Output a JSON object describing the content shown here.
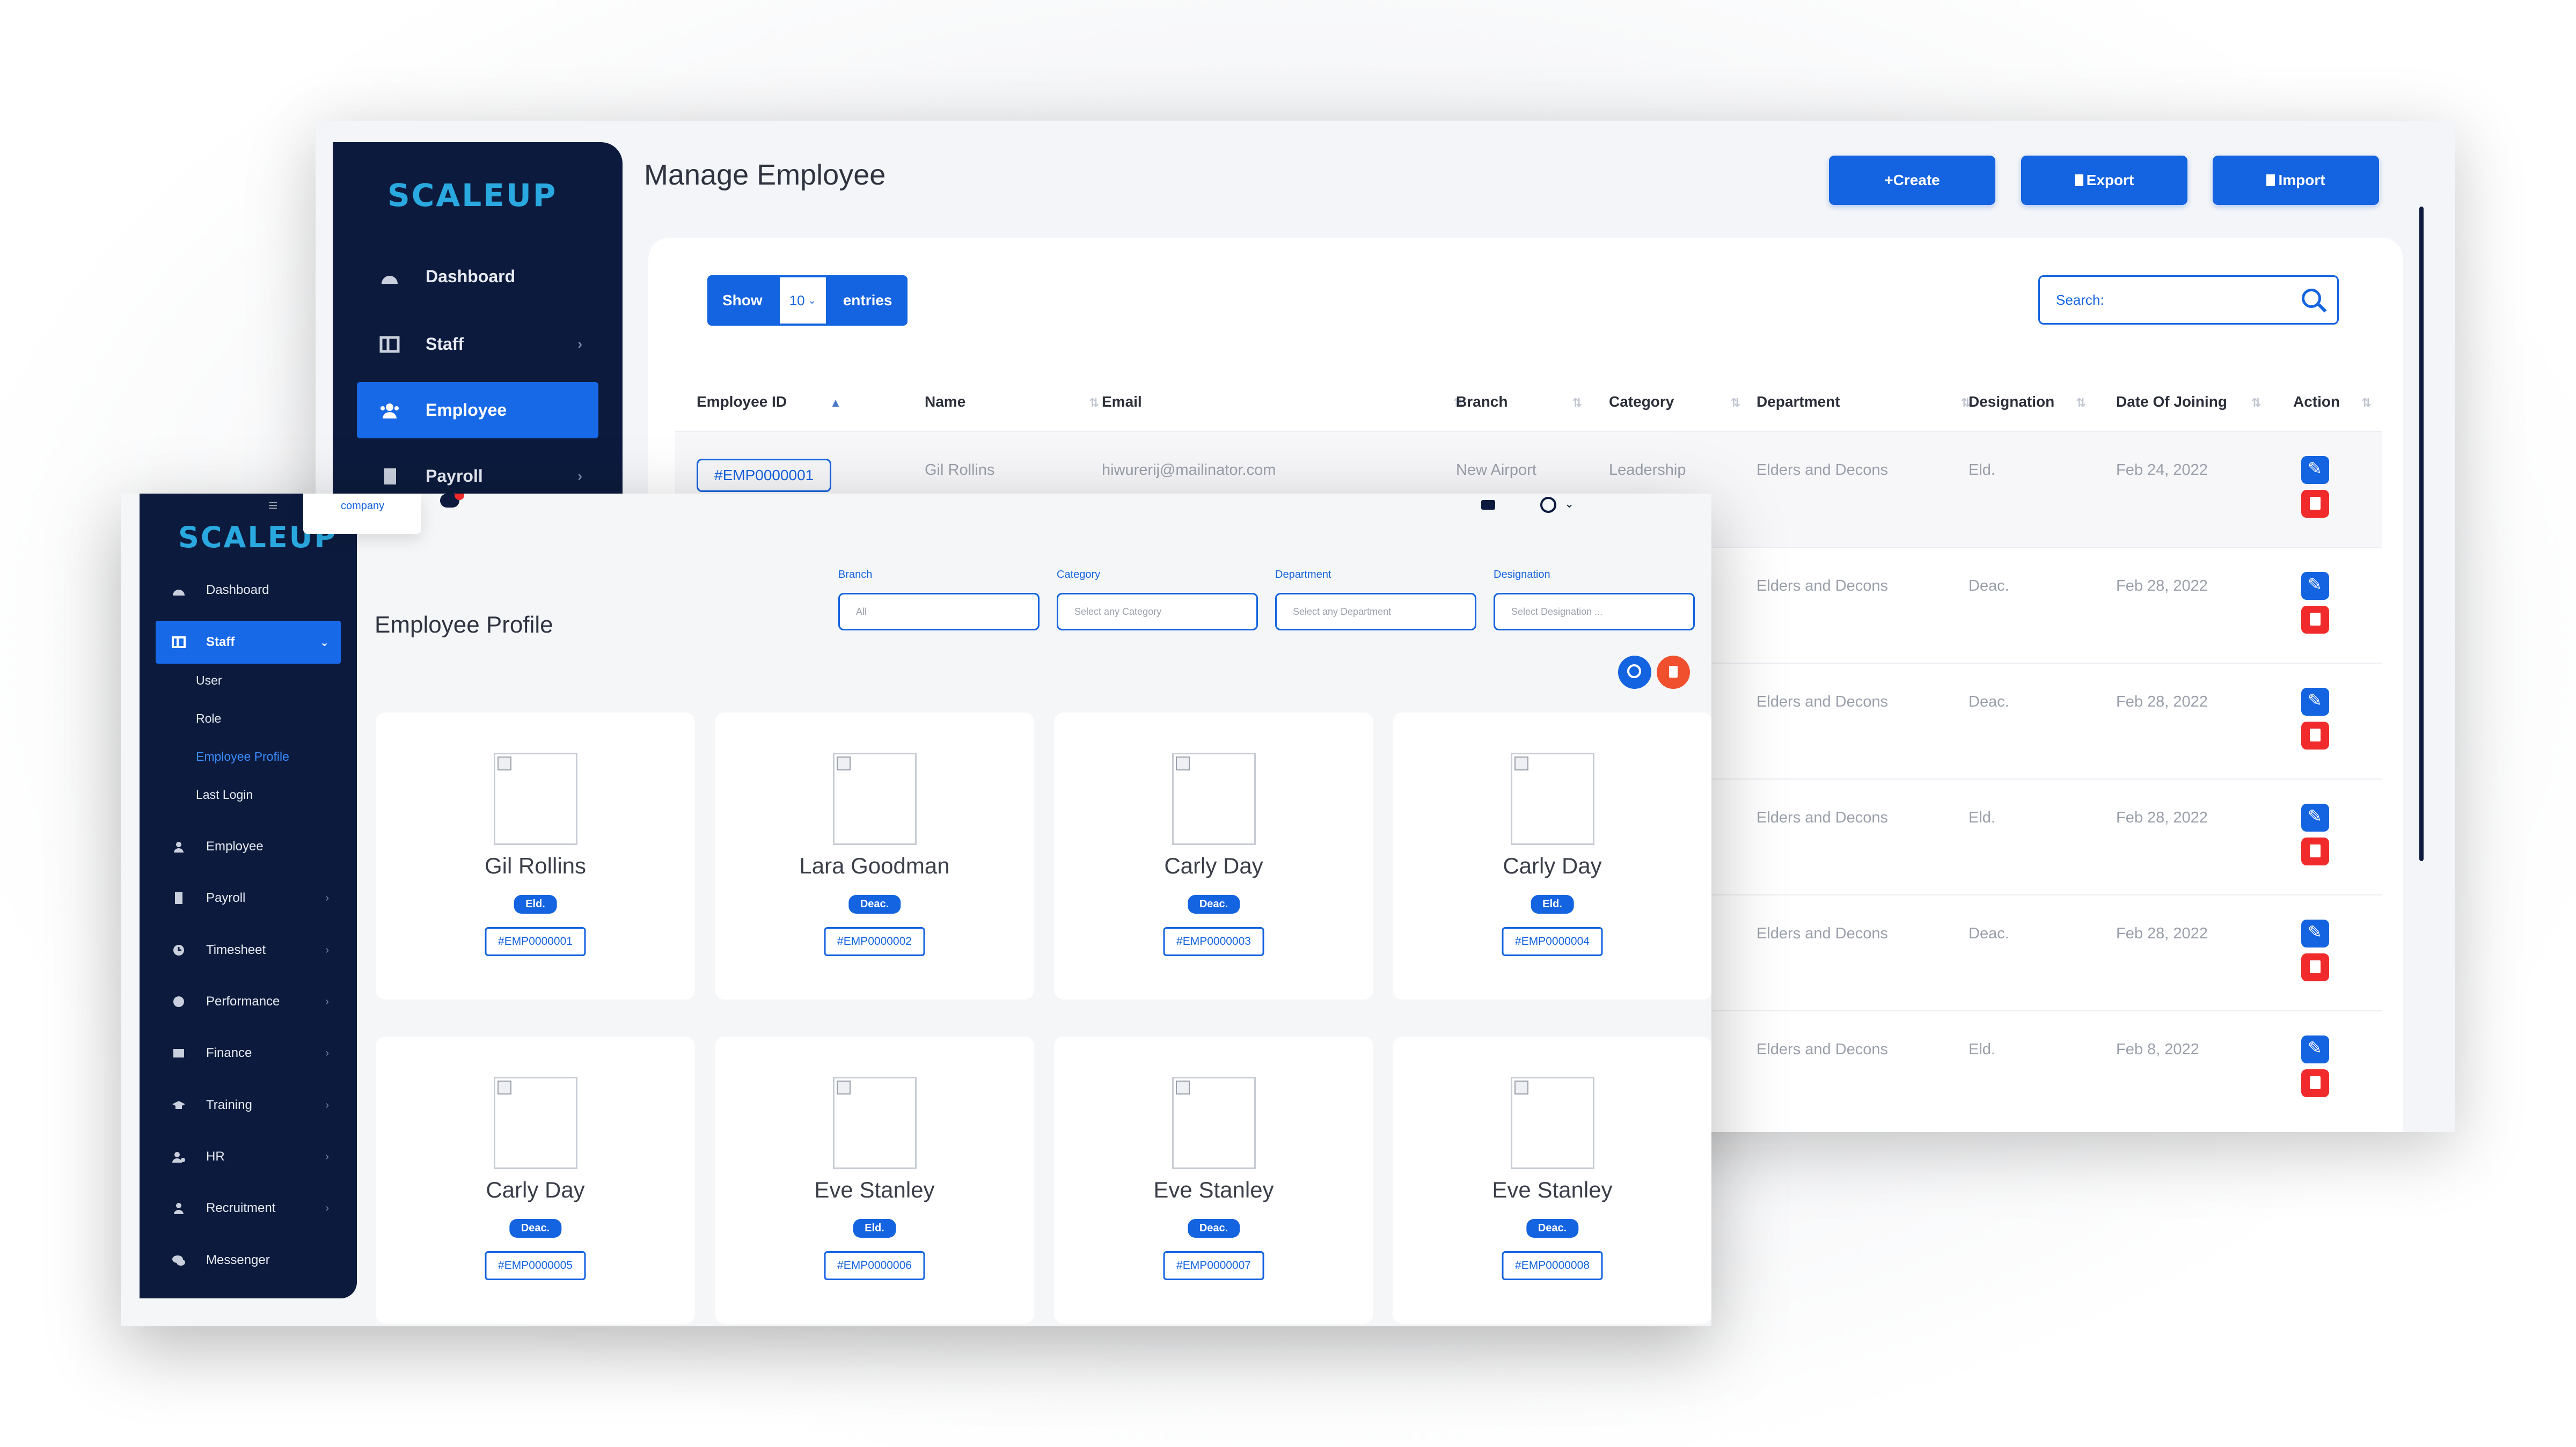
{
  "back_window": {
    "logo": "SCALEUP",
    "title": "Manage Employee",
    "sidebar": [
      {
        "label": "Dashboard",
        "icon": "dashboard-icon",
        "chevron": false,
        "active": false
      },
      {
        "label": "Staff",
        "icon": "staff-icon",
        "chevron": true,
        "active": false
      },
      {
        "label": "Employee",
        "icon": "users-icon",
        "chevron": false,
        "active": true
      },
      {
        "label": "Payroll",
        "icon": "payroll-icon",
        "chevron": true,
        "active": false
      }
    ],
    "buttons": {
      "create": "+Create",
      "export": "Export",
      "import": "Import"
    },
    "show_label": "Show",
    "show_value": "10",
    "entries_label": "entries",
    "search_placeholder": "Search:",
    "columns": [
      "Employee ID",
      "Name",
      "Email",
      "Branch",
      "Category",
      "Department",
      "Designation",
      "Date Of Joining",
      "Action"
    ],
    "rows": [
      {
        "id": "#EMP0000001",
        "name": "Gil Rollins",
        "email": "hiwurerij@mailinator.com",
        "branch": "New Airport",
        "category": "Leadership",
        "department": "Elders and Decons",
        "designation": "Eld.",
        "date": "Feb 24, 2022"
      },
      {
        "department": "Elders and Decons",
        "designation": "Deac.",
        "date": "Feb 28, 2022"
      },
      {
        "department": "Elders and Decons",
        "designation": "Deac.",
        "date": "Feb 28, 2022"
      },
      {
        "department": "Elders and Decons",
        "designation": "Eld.",
        "date": "Feb 28, 2022"
      },
      {
        "department": "Elders and Decons",
        "designation": "Deac.",
        "date": "Feb 28, 2022"
      },
      {
        "department": "Elders and Decons",
        "designation": "Eld.",
        "date": "Feb 8, 2022"
      }
    ]
  },
  "front_window": {
    "logo": "SCALEUP",
    "title": "Employee Profile",
    "company_label": "company",
    "sidebar": {
      "dashboard": "Dashboard",
      "staff": "Staff",
      "staff_sub": [
        "User",
        "Role",
        "Employee Profile",
        "Last Login"
      ],
      "items": [
        "Employee",
        "Payroll",
        "Timesheet",
        "Performance",
        "Finance",
        "Training",
        "HR",
        "Recruitment",
        "Messenger"
      ]
    },
    "filters": [
      {
        "label": "Branch",
        "value": "All"
      },
      {
        "label": "Category",
        "value": "Select any Category"
      },
      {
        "label": "Department",
        "value": "Select any Department"
      },
      {
        "label": "Designation",
        "value": "Select Designation ..."
      }
    ],
    "cards": [
      {
        "name": "Gil Rollins",
        "badge": "Eld.",
        "code": "#EMP0000001"
      },
      {
        "name": "Lara Goodman",
        "badge": "Deac.",
        "code": "#EMP0000002"
      },
      {
        "name": "Carly Day",
        "badge": "Deac.",
        "code": "#EMP0000003"
      },
      {
        "name": "Carly Day",
        "badge": "Eld.",
        "code": "#EMP0000004"
      },
      {
        "name": "Carly Day",
        "badge": "Deac.",
        "code": "#EMP0000005"
      },
      {
        "name": "Eve Stanley",
        "badge": "Eld.",
        "code": "#EMP0000006"
      },
      {
        "name": "Eve Stanley",
        "badge": "Deac.",
        "code": "#EMP0000007"
      },
      {
        "name": "Eve Stanley",
        "badge": "Deac.",
        "code": "#EMP0000008"
      }
    ]
  },
  "colors": {
    "primary": "#1463e0",
    "sidebar": "#0c1b3d",
    "danger": "#f12b2b",
    "logo": "#2aa9e0"
  }
}
